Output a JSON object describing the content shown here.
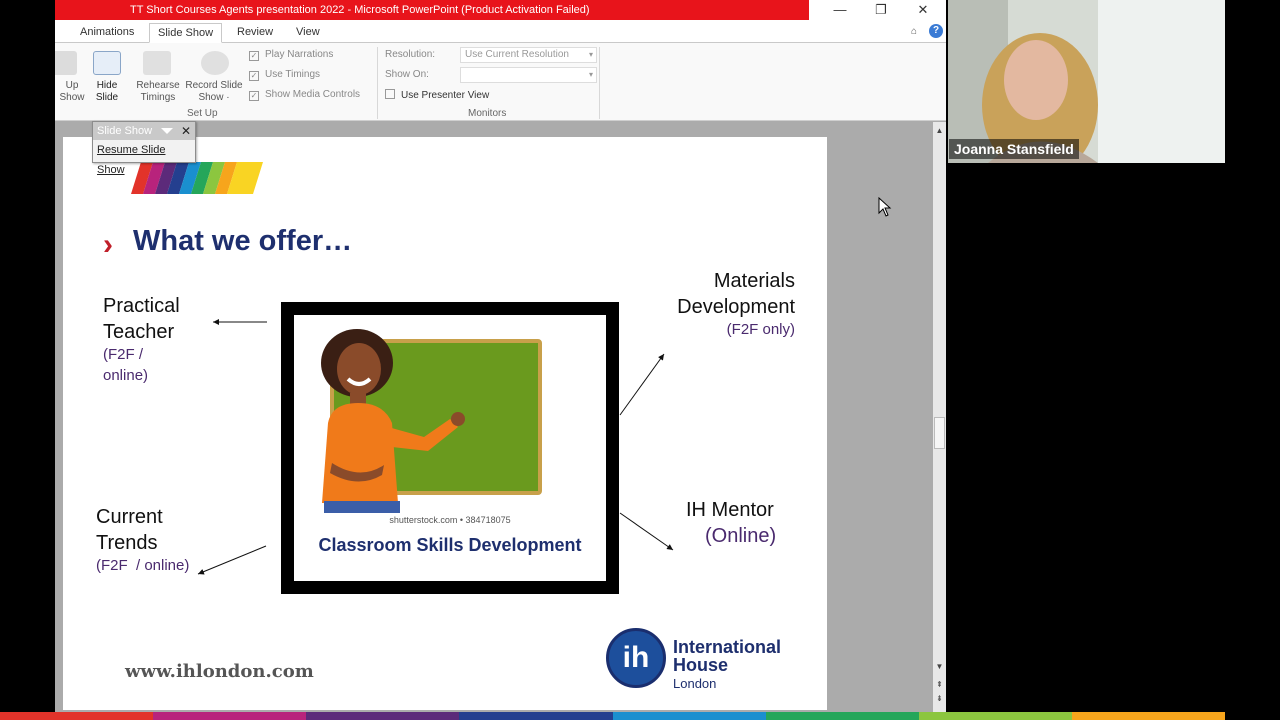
{
  "window": {
    "title": "TT Short Courses Agents presentation 2022 - Microsoft PowerPoint (Product Activation Failed)",
    "min": "—",
    "restore": "❐",
    "close": "✕"
  },
  "tabs": [
    "Animations",
    "Slide Show",
    "Review",
    "View"
  ],
  "ribbon": {
    "setup_up_show": "Up\nShow",
    "hide_slide": "Hide\nSlide",
    "rehearse_timings": "Rehearse\nTimings",
    "record_slide_show": "Record Slide\nShow ·",
    "setup_group": "Set Up",
    "play_narrations": "Play Narrations",
    "use_timings": "Use Timings",
    "show_media_controls": "Show Media Controls",
    "resolution_label": "Resolution:",
    "resolution_value": "Use Current Resolution",
    "show_on_label": "Show On:",
    "use_presenter_view": "Use Presenter View",
    "monitors_group": "Monitors"
  },
  "floatbar": {
    "title": "Slide Show",
    "resume": "Resume Slide Show"
  },
  "slide": {
    "title": "What we offer…",
    "practical": "Practical\nTeacher",
    "practical_sub": "(F2F /\nonline)",
    "materials": "Materials\nDevelopment",
    "materials_sub": "(F2F only)",
    "trends": "Current\nTrends",
    "trends_sub": "(F2F  / online)",
    "mentor": "IH Mentor",
    "mentor_sub": "(Online)",
    "watermark": "shutterstock.com • 384718075",
    "caption": "Classroom Skills Development",
    "url": "www.ihlondon.com",
    "logo_mark": "ih",
    "logo_name": "International\nHouse",
    "logo_city": "London"
  },
  "participant": {
    "name": "Joanna Stansfield"
  },
  "colors": {
    "title_bar": "#e8141b",
    "slide_title": "#1e2f6e",
    "accent_purple": "#4a2a6e"
  }
}
